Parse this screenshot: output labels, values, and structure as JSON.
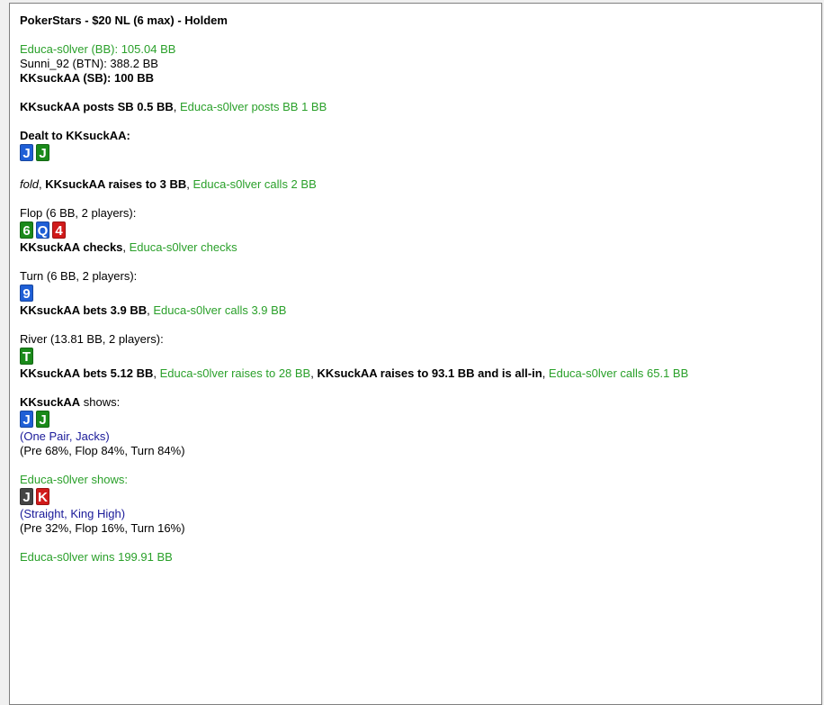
{
  "title": "PokerStars - $20 NL (6 max) - Holdem",
  "players": [
    {
      "text": "Educa-s0lver (BB): 105.04 BB",
      "style": "green"
    },
    {
      "text": "Sunni_92 (BTN): 388.2 BB",
      "style": ""
    },
    {
      "text": "KKsuckAA (SB): 100 BB",
      "style": "b"
    }
  ],
  "blinds": [
    {
      "text": "KKsuckAA posts SB 0.5 BB",
      "style": "b"
    },
    {
      "text": ", ",
      "style": ""
    },
    {
      "text": "Educa-s0lver posts BB 1 BB",
      "style": "green"
    }
  ],
  "dealt_label": "Dealt to KKsuckAA:",
  "hole_cards": [
    {
      "rank": "J",
      "color": "#1f5fd6"
    },
    {
      "rank": "J",
      "color": "#1a8a1a"
    }
  ],
  "preflop": [
    {
      "text": "fold",
      "style": "i"
    },
    {
      "text": ", ",
      "style": ""
    },
    {
      "text": "KKsuckAA raises to 3 BB",
      "style": "b"
    },
    {
      "text": ", ",
      "style": ""
    },
    {
      "text": "Educa-s0lver calls 2 BB",
      "style": "green"
    }
  ],
  "flop_label": "Flop (6 BB, 2 players):",
  "flop_cards": [
    {
      "rank": "6",
      "color": "#1a8a1a"
    },
    {
      "rank": "Q",
      "color": "#1f5fd6"
    },
    {
      "rank": "4",
      "color": "#d01a1a"
    }
  ],
  "flop_actions": [
    {
      "text": "KKsuckAA checks",
      "style": "b"
    },
    {
      "text": ", ",
      "style": ""
    },
    {
      "text": "Educa-s0lver checks",
      "style": "green"
    }
  ],
  "turn_label": "Turn (6 BB, 2 players):",
  "turn_cards": [
    {
      "rank": "9",
      "color": "#1f5fd6"
    }
  ],
  "turn_actions": [
    {
      "text": "KKsuckAA bets 3.9 BB",
      "style": "b"
    },
    {
      "text": ", ",
      "style": ""
    },
    {
      "text": "Educa-s0lver calls 3.9 BB",
      "style": "green"
    }
  ],
  "river_label": "River (13.81 BB, 2 players):",
  "river_cards": [
    {
      "rank": "T",
      "color": "#1a8a1a"
    }
  ],
  "river_actions": [
    {
      "text": "KKsuckAA bets 5.12 BB",
      "style": "b"
    },
    {
      "text": ", ",
      "style": ""
    },
    {
      "text": "Educa-s0lver raises to 28 BB",
      "style": "green"
    },
    {
      "text": ", ",
      "style": ""
    },
    {
      "text": "KKsuckAA raises to 93.1 BB and is all-in",
      "style": "b"
    },
    {
      "text": ", ",
      "style": ""
    },
    {
      "text": "Educa-s0lver calls 65.1 BB",
      "style": "green"
    }
  ],
  "showdown1": {
    "name": "KKsuckAA",
    "shows": " shows:",
    "cards": [
      {
        "rank": "J",
        "color": "#1f5fd6"
      },
      {
        "rank": "J",
        "color": "#1a8a1a"
      }
    ],
    "hand": "(One Pair, Jacks)",
    "equity": "(Pre 68%, Flop 84%, Turn 84%)"
  },
  "showdown2": {
    "label": "Educa-s0lver shows:",
    "cards": [
      {
        "rank": "J",
        "color": "#444444"
      },
      {
        "rank": "K",
        "color": "#d01a1a"
      }
    ],
    "hand": "(Straight, King High)",
    "equity": "(Pre 32%, Flop 16%, Turn 16%)"
  },
  "result": "Educa-s0lver wins 199.91 BB"
}
